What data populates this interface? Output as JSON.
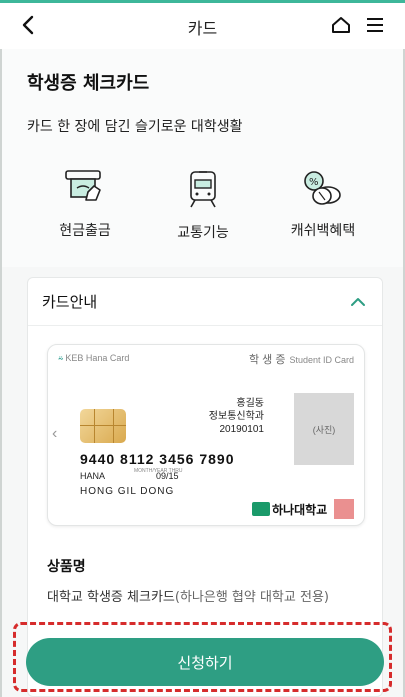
{
  "header": {
    "title": "카드",
    "back_icon": "chevron-left-icon",
    "home_icon": "home-icon",
    "menu_icon": "hamburger-menu-icon"
  },
  "page": {
    "title": "학생증 체크카드",
    "subtitle": "카드 한 장에 담긴 슬기로운 대학생활"
  },
  "features": [
    {
      "label": "현금출금",
      "icon": "atm-cash-icon"
    },
    {
      "label": "교통기능",
      "icon": "train-icon"
    },
    {
      "label": "캐쉬백혜택",
      "icon": "coins-cashback-icon"
    }
  ],
  "card_info": {
    "section_title": "카드안내",
    "toggle_icon": "chevron-up-icon",
    "card_image": {
      "bank": "KEB Hana Card",
      "card_type": "학 생 증",
      "card_type_en": "Student ID Card",
      "holder_name_ko": "홍길동",
      "department": "정보통신학과",
      "student_id": "20190101",
      "photo_label": "(사진)",
      "card_number": "9440 8112 3456 7890",
      "bank_name": "HANA",
      "valid_label": "MONTH/YEAR THRU",
      "valid_thru": "09/15",
      "holder_name_en": "HONG GIL DONG",
      "university": "하나대학교"
    },
    "product_label": "상품명",
    "product_name": "대학교 학생증 체크카드",
    "product_note": "(하나은행 협약 대학교 전용)"
  },
  "apply_button": "신청하기",
  "colors": {
    "accent": "#2e9e83",
    "highlight": "#d62c2c"
  }
}
